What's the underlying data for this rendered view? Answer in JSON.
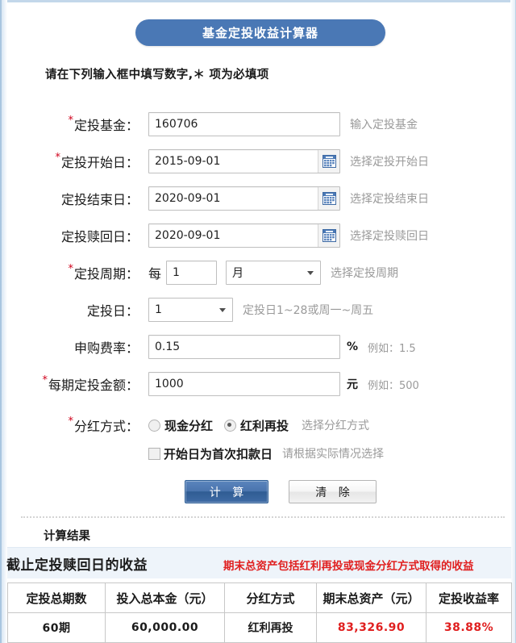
{
  "header": {
    "title": "基金定投收益计算器",
    "banner_color": "#4a78b5",
    "hint": "请在下列输入框中填写数字,＊ 项为必填项"
  },
  "form": {
    "required_mark": "*",
    "rows": [
      {
        "label": "定投基金：",
        "required": true,
        "value": "160706",
        "tip": "输入定投基金"
      },
      {
        "label": "定投开始日：",
        "required": true,
        "value": "2015-09-01",
        "tip": "选择定投开始日"
      },
      {
        "label": "定投结束日：",
        "required": false,
        "value": "2020-09-01",
        "tip": "选择定投结束日"
      },
      {
        "label": "定投赎回日：",
        "required": false,
        "value": "2020-09-01",
        "tip": "选择定投赎回日"
      },
      {
        "label": "定投周期：",
        "required": true,
        "prefix": "每",
        "value": "1",
        "unit_selected": "月",
        "tip": "选择定投周期"
      },
      {
        "label": "定投日：",
        "required": false,
        "value": "1",
        "tip": "定投日1~28或周一~周五"
      },
      {
        "label": "申购费率：",
        "required": false,
        "value": "0.15",
        "unit": "%",
        "tip": "例如：1.5"
      },
      {
        "label": "每期定投金额：",
        "required": true,
        "value": "1000",
        "unit": "元",
        "tip": "例如：500"
      },
      {
        "label": "分红方式：",
        "required": true,
        "tip": "选择分红方式"
      }
    ],
    "dividend": {
      "option_cash": "现金分红",
      "option_reinvest": "红利再投",
      "selected": "红利再投",
      "tip": "选择分红方式",
      "checkbox_label": "开始日为首次扣款日",
      "checkbox_checked": false,
      "checkbox_tip": "请根据实际情况选择"
    },
    "buttons": {
      "calculate": "计 算",
      "clear": "清 除"
    }
  },
  "result": {
    "section_title": "计算结果",
    "band_left": "截止定投赎回日的收益",
    "band_note": "期末总资产包括红利再投或现金分红方式取得的收益",
    "note_color": "#e02020",
    "table": {
      "columns": [
        "定投总期数",
        "投入总本金（元）",
        "分红方式",
        "期末总资产（元）",
        "定投收益率"
      ],
      "rows": [
        [
          "60期",
          "60,000.00",
          "红利再投",
          "83,326.90",
          "38.88%"
        ]
      ],
      "highlight_columns": [
        3,
        4
      ]
    }
  },
  "icons": {
    "calendar": "calendar-icon",
    "caret": "chevron-down-icon"
  }
}
